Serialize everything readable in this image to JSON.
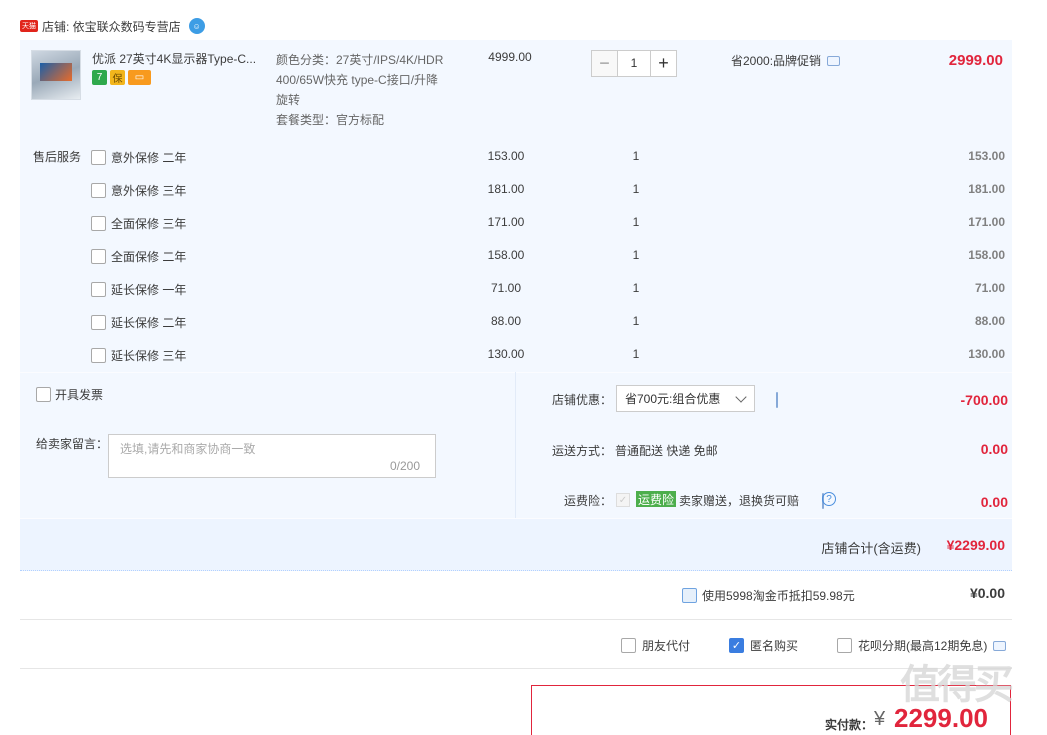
{
  "shop": {
    "badge": "天猫",
    "label": "店铺: 依宝联众数码专营店",
    "ww_icon": "wangwang-icon"
  },
  "item": {
    "title": "优派 27英寸4K显示器Type-C...",
    "badges": [
      "7",
      "保",
      "▭"
    ],
    "sku_line1": "颜色分类：27英寸/IPS/4K/HDR",
    "sku_line2": "400/65W快充 type-C接口/升降",
    "sku_line3": "旋转",
    "sku_line4": "套餐类型：官方标配",
    "price": "4999.00",
    "quantity": "1",
    "minus": "−",
    "plus": "+",
    "promo": "省2000:品牌促销",
    "subtotal": "2999.00"
  },
  "services": {
    "label": "售后服务",
    "rows": [
      {
        "name": "意外保修 二年",
        "price": "153.00",
        "qty": "1",
        "subtotal": "153.00"
      },
      {
        "name": "意外保修 三年",
        "price": "181.00",
        "qty": "1",
        "subtotal": "181.00"
      },
      {
        "name": "全面保修 三年",
        "price": "171.00",
        "qty": "1",
        "subtotal": "171.00"
      },
      {
        "name": "全面保修 二年",
        "price": "158.00",
        "qty": "1",
        "subtotal": "158.00"
      },
      {
        "name": "延长保修 一年",
        "price": "71.00",
        "qty": "1",
        "subtotal": "71.00"
      },
      {
        "name": "延长保修 二年",
        "price": "88.00",
        "qty": "1",
        "subtotal": "88.00"
      },
      {
        "name": "延长保修 三年",
        "price": "130.00",
        "qty": "1",
        "subtotal": "130.00"
      }
    ]
  },
  "invoice": {
    "label": "开具发票"
  },
  "message": {
    "label": "给卖家留言：",
    "placeholder": "选填,请先和商家协商一致",
    "count": "0/200"
  },
  "coupon": {
    "label": "店铺优惠：",
    "selected": "省700元:组合优惠",
    "value": "-700.00"
  },
  "shipping": {
    "label": "运送方式：",
    "method": "普通配送 快递 免邮",
    "value": "0.00"
  },
  "insurance": {
    "label": "运费险：",
    "tag": "运费险",
    "text": "卖家赠送，退换货可赔",
    "value": "0.00",
    "help": "?"
  },
  "shop_total": {
    "label": "店铺合计(含运费)",
    "value": "¥2299.00"
  },
  "coins": {
    "label": "使用5998淘金币抵扣59.98元",
    "value": "¥0.00"
  },
  "options": {
    "friend_pay": "朋友代付",
    "anonymous": "匿名购买",
    "anonymous_checked": true,
    "huabei": "花呗分期(最高12期免息)"
  },
  "payment": {
    "label": "实付款：",
    "currency": "¥",
    "value": "2299.00"
  },
  "watermark": "值得买",
  "colors": {
    "accent_red": "#e1253c",
    "panel_bg": "#f3f8ff",
    "check_blue": "#3a7de0"
  }
}
